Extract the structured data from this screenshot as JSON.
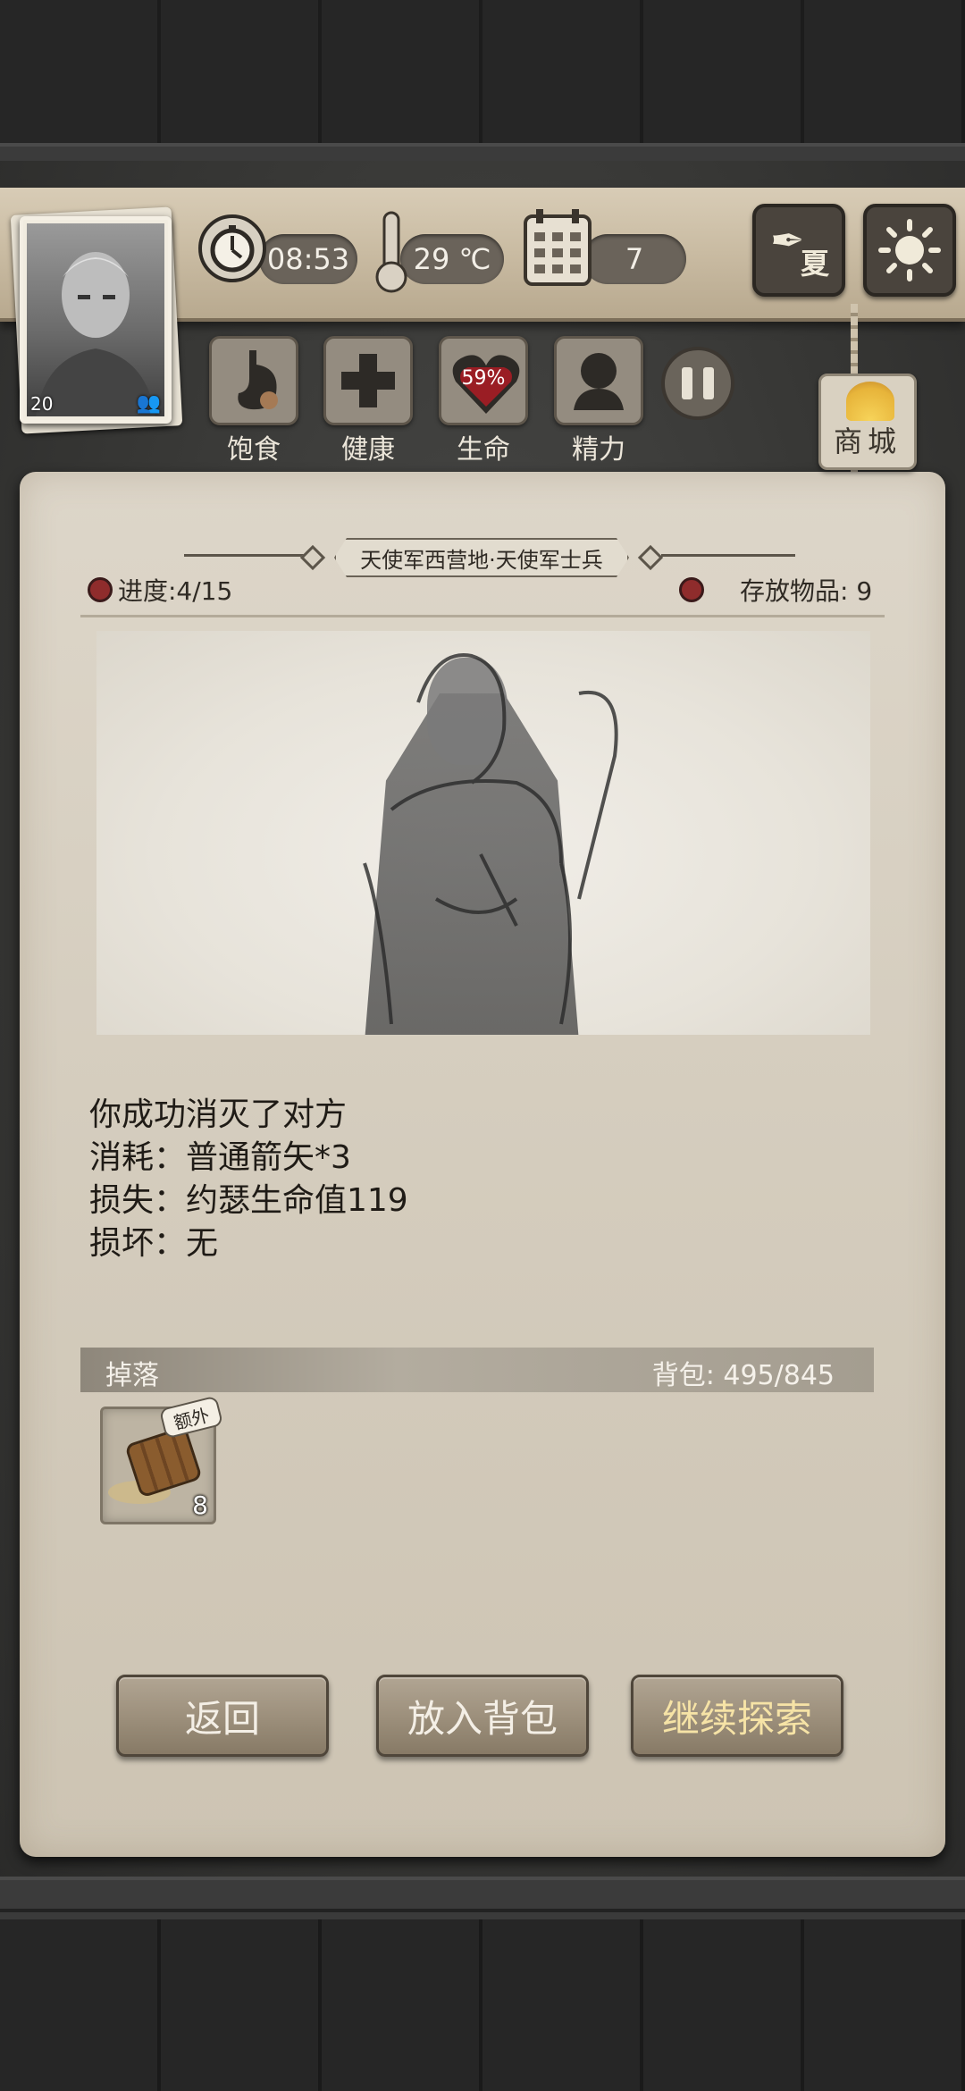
{
  "hud": {
    "time": "08:53",
    "temperature": "29 ℃",
    "day": "7",
    "season": "夏",
    "level": "20"
  },
  "status": [
    {
      "label": "饱食"
    },
    {
      "label": "健康"
    },
    {
      "label": "生命",
      "value": "59%"
    },
    {
      "label": "精力"
    }
  ],
  "shop": {
    "label": "商城"
  },
  "panel": {
    "location": "天使军西营地·天使军士兵",
    "progress": "进度:4/15",
    "stored": "存放物品: 9"
  },
  "result": {
    "line1": "你成功消灭了对方",
    "line2": "消耗：普通箭矢*3",
    "line3": "损失：约瑟生命值119",
    "line4": "损坏：无"
  },
  "loot": {
    "header": "掉落",
    "backpack": "背包: 495/845",
    "items": [
      {
        "icon": "spilled-barrel-icon",
        "badge": "额外",
        "count": "8"
      }
    ]
  },
  "actions": {
    "back": "返回",
    "store": "放入背包",
    "continue": "继续探索"
  },
  "colors": {
    "continue_text": "#f6e3a6",
    "normal_text": "#f4efe6",
    "health_heart": "#9a1d24"
  }
}
